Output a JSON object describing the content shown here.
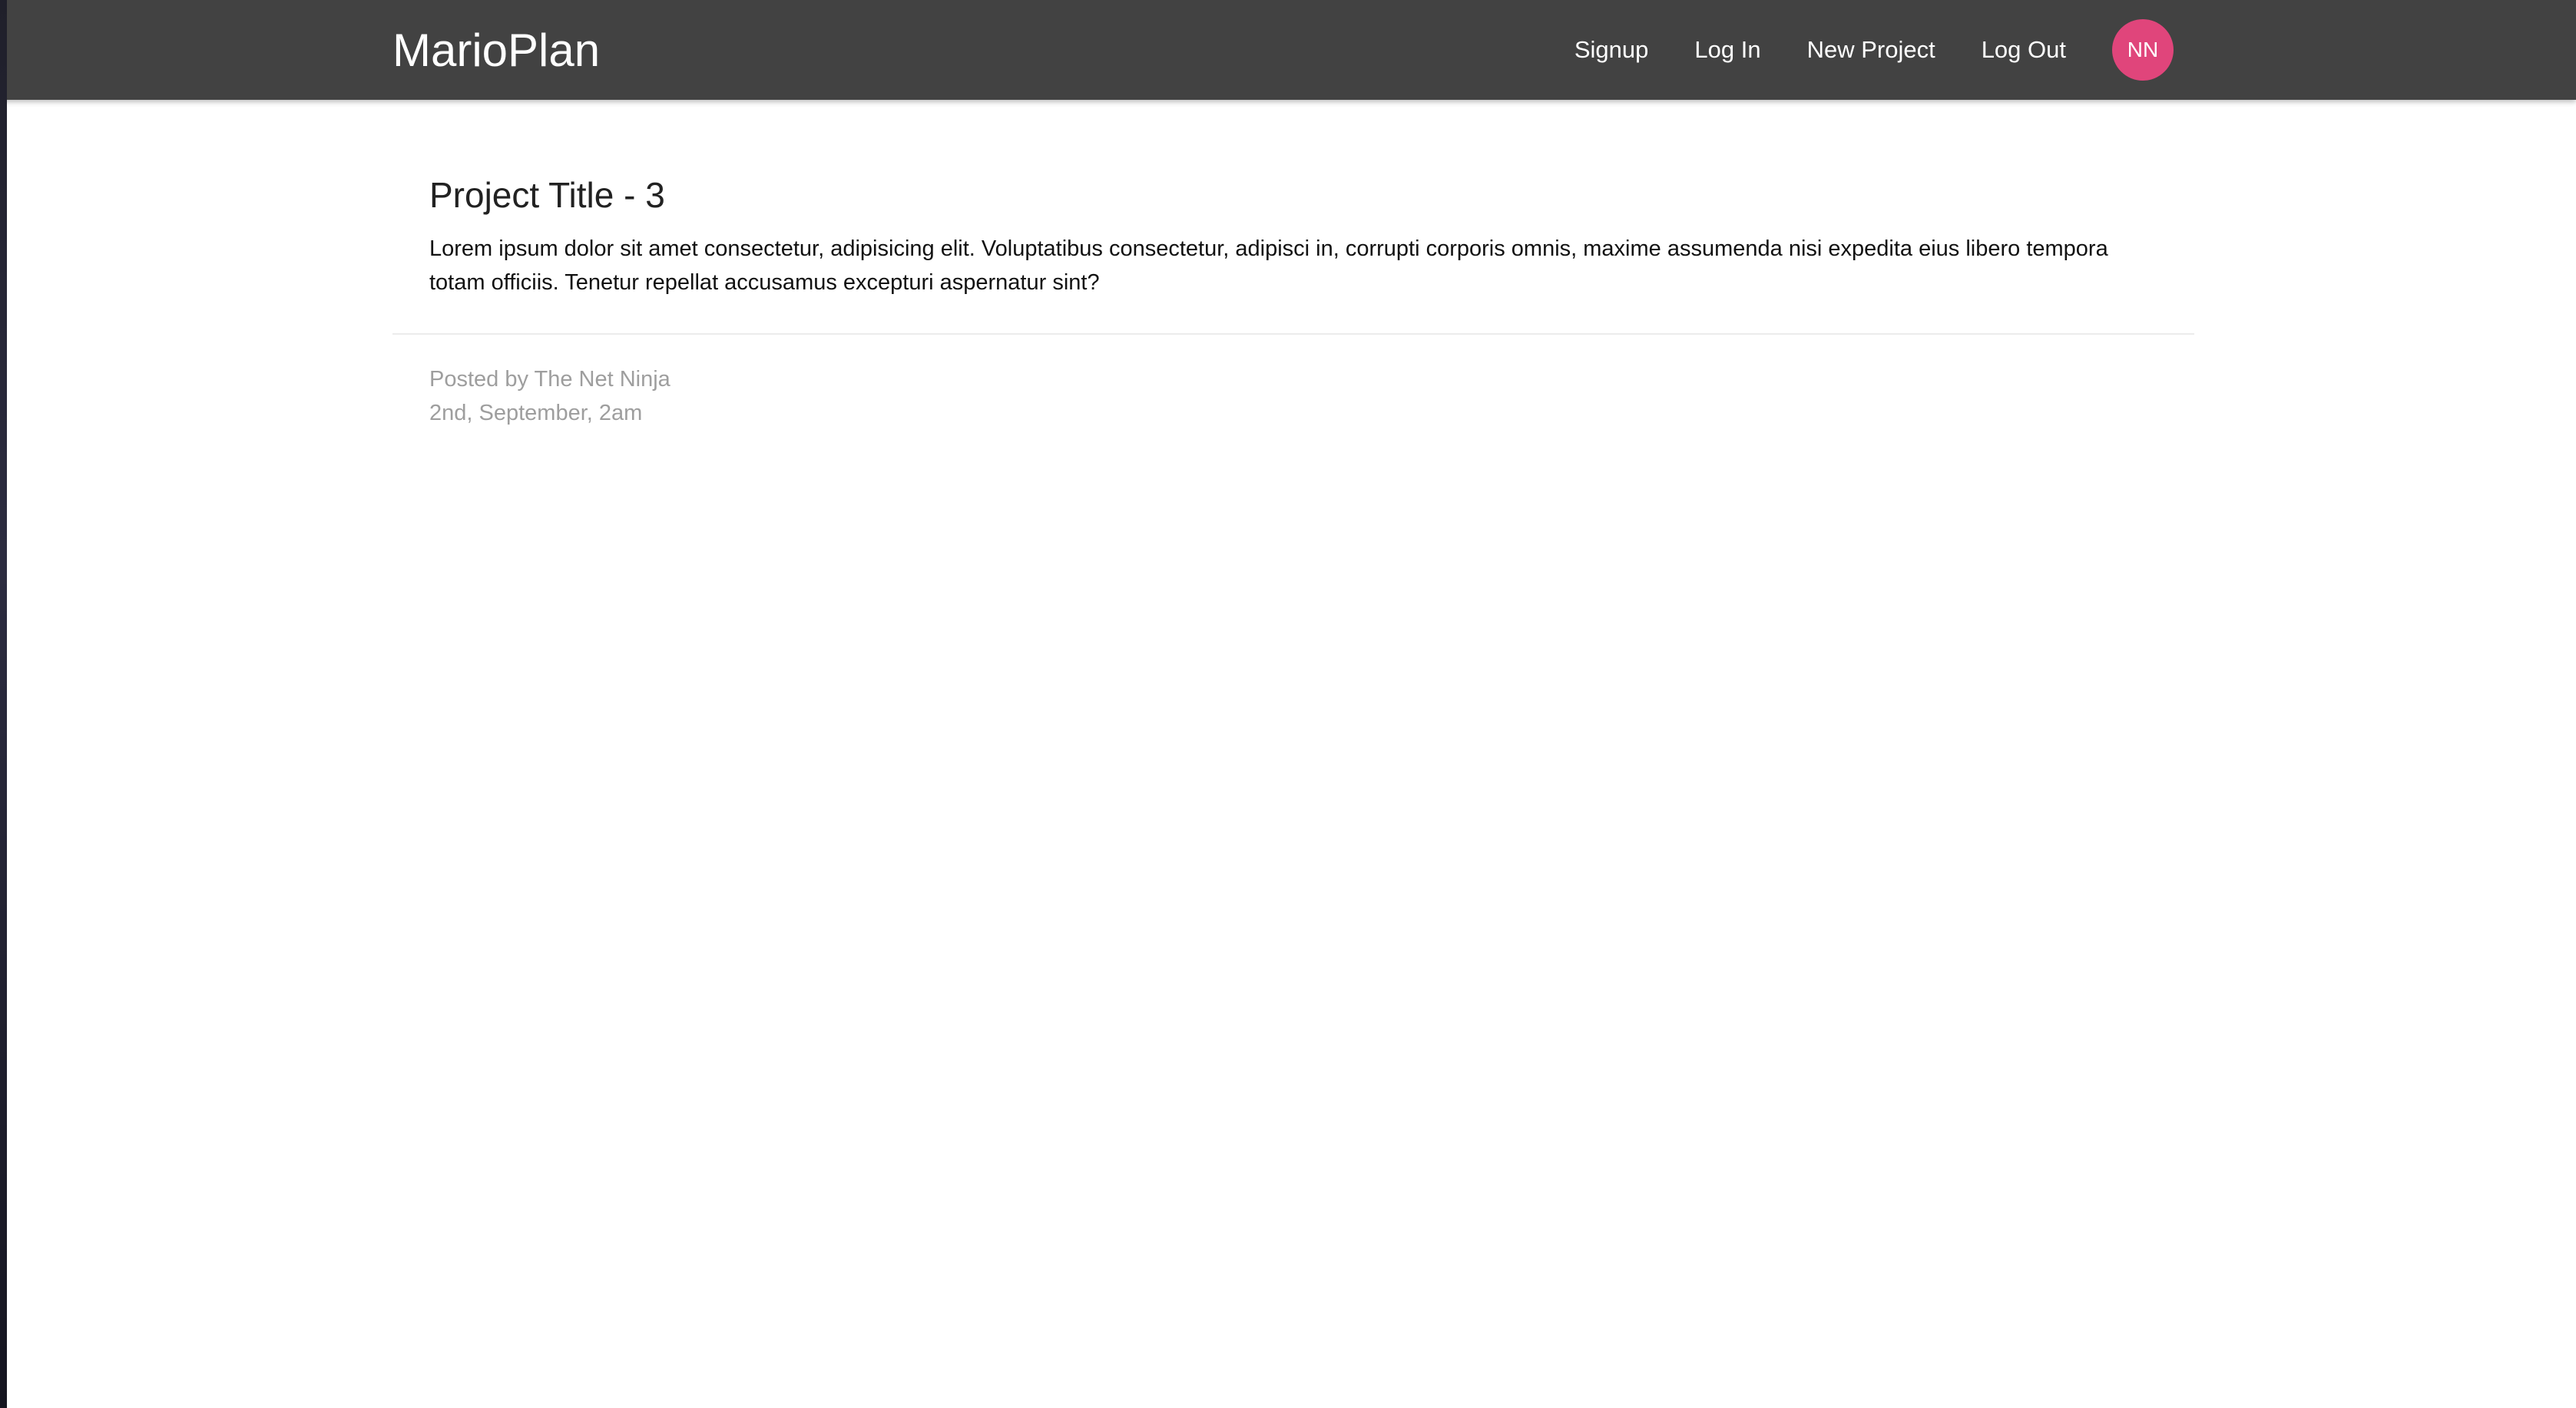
{
  "navbar": {
    "brand": "MarioPlan",
    "links": {
      "signup": "Signup",
      "login": "Log In",
      "new_project": "New Project",
      "logout": "Log Out"
    },
    "avatar_initials": "NN",
    "avatar_color": "#e0457b",
    "background_color": "#424242"
  },
  "project": {
    "title": "Project Title - 3",
    "content": "Lorem ipsum dolor sit amet consectetur, adipisicing elit. Voluptatibus consectetur, adipisci in, corrupti corporis omnis, maxime assumenda nisi expedita eius libero tempora totam officiis. Tenetur repellat accusamus excepturi aspernatur sint?",
    "posted_by": "Posted by The Net Ninja",
    "date": "2nd, September, 2am"
  }
}
